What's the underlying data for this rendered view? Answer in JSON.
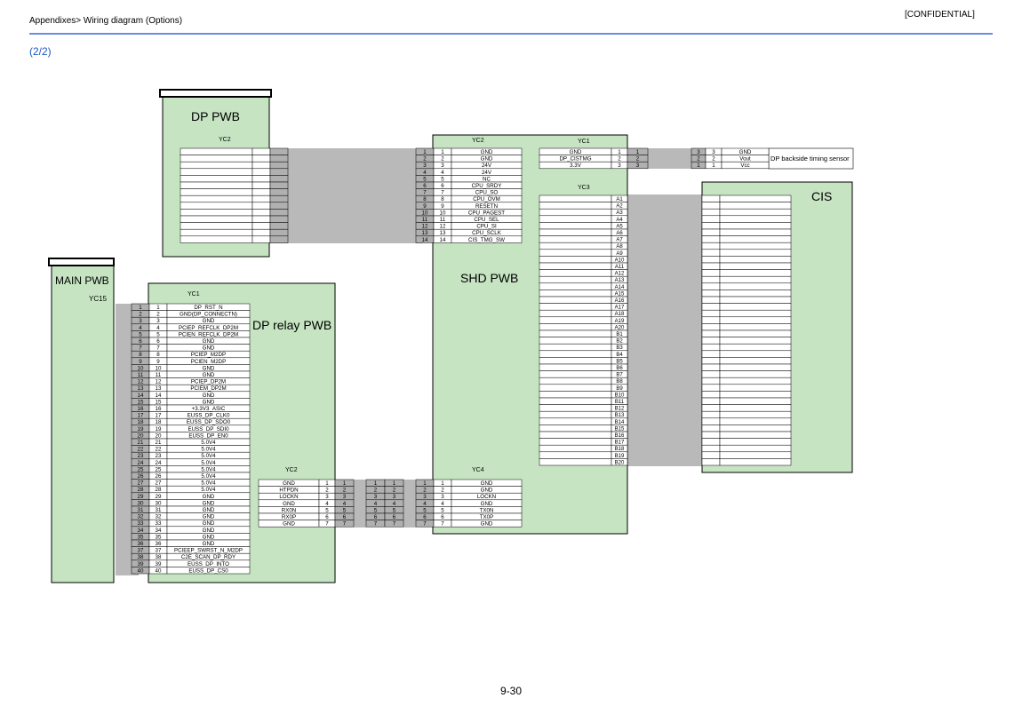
{
  "header": {
    "breadcrumb": "Appendixes> Wiring diagram (Options)",
    "confidential": "[CONFIDENTIAL]",
    "page_indicator": "(2/2)"
  },
  "footer": {
    "page_number": "9-30"
  },
  "colors": {
    "board_fill": "#c6e4c2",
    "cable": "#b9b9b9",
    "rule": "#6b8fdc",
    "accent_text": "#1a56c8"
  },
  "boards": {
    "dp_pwb": {
      "label": "DP PWB",
      "connector": "YC2"
    },
    "main_pwb": {
      "label": "MAIN PWB",
      "connector": "YC15"
    },
    "dp_relay_pwb": {
      "label": "DP relay PWB",
      "connector_left": "YC1",
      "connector_right": "YC2"
    },
    "shd_pwb": {
      "label": "SHD PWB",
      "connector_top_left": "YC2",
      "connector_top_right": "YC1",
      "connector_right": "YC3",
      "connector_bottom": "YC4"
    },
    "cis": {
      "label": "CIS"
    },
    "timing_sensor": {
      "label": "DP backside timing sensor"
    }
  },
  "signals": {
    "relay_yc1": [
      "DP_RST_N",
      "GND(DP_CONNECTN)",
      "GND",
      "PCIEP_REFCLK_DP2M",
      "PCIEN_REFCLK_DP2M",
      "GND",
      "GND",
      "PCIEP_M2DP",
      "PCIEN_M2DP",
      "GND",
      "GND",
      "PCIEP_DP2M",
      "PCIEM_DP2M",
      "GND",
      "GND",
      "+3.3V3_ASIC",
      "EUSS_DP_CLK0",
      "EUSS_DP_SDO0",
      "EUSS_DP_SDI0",
      "EUSS_DP_EN0",
      "5.0V4",
      "5.0V4",
      "5.0V4",
      "5.0V4",
      "5.0V4",
      "5.0V4",
      "5.0V4",
      "5.0V4",
      "GND",
      "GND",
      "GND",
      "GND",
      "GND",
      "GND",
      "GND",
      "GND",
      "PCIEEP_SWRST_N_M2DP",
      "C2E_SCAN_DP_RDY",
      "EUSS_DP_INTO",
      "EUSS_DP_CS0"
    ],
    "shd_yc2": [
      "GND",
      "GND",
      "24V",
      "24V",
      "NC",
      "CPU_SRDY",
      "CPU_SO",
      "CPU_OVM",
      "RESETN",
      "CPU_PAGEST",
      "CPU_SEL",
      "CPU_SI",
      "CPU_SCLK",
      "CIS_TMG_SW"
    ],
    "shd_yc1": [
      "GND",
      "DP_CISTMG",
      "3.3V"
    ],
    "sensor": [
      "GND",
      "Vout",
      "Vcc"
    ],
    "relay_yc2": [
      "GND",
      "HTPDN",
      "LOCKN",
      "GND",
      "RX0N",
      "RX0P",
      "GND"
    ],
    "shd_yc4": [
      "GND",
      "GND",
      "LOCKN",
      "GND",
      "TX0N",
      "TX0P",
      "GND"
    ],
    "yc3_pins": [
      "A1",
      "A2",
      "A3",
      "A4",
      "A5",
      "A6",
      "A7",
      "A8",
      "A9",
      "A10",
      "A11",
      "A12",
      "A13",
      "A14",
      "A15",
      "A16",
      "A17",
      "A18",
      "A19",
      "A20",
      "B1",
      "B2",
      "B3",
      "B4",
      "B5",
      "B6",
      "B7",
      "B8",
      "B9",
      "B10",
      "B11",
      "B12",
      "B13",
      "B14",
      "B15",
      "B16",
      "B17",
      "B18",
      "B19",
      "B20"
    ]
  }
}
